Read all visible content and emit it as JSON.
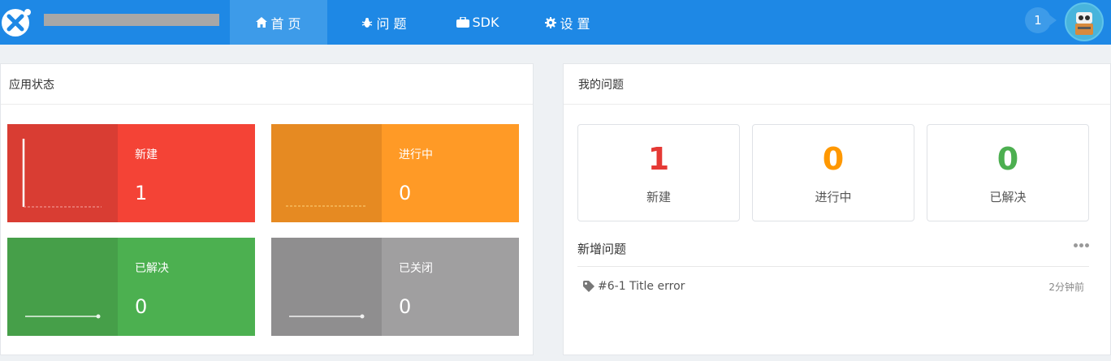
{
  "nav": {
    "home": "首 页",
    "issues": "问 题",
    "sdk": "SDK",
    "settings": "设 置"
  },
  "notifications": {
    "count": "1"
  },
  "app_status": {
    "title": "应用状态",
    "tiles": [
      {
        "label": "新建",
        "value": "1",
        "spark_color": "#ffffff"
      },
      {
        "label": "进行中",
        "value": "0"
      },
      {
        "label": "已解决",
        "value": "0"
      },
      {
        "label": "已关闭",
        "value": "0"
      }
    ]
  },
  "my_issues": {
    "title": "我的问题",
    "stats": [
      {
        "value": "1",
        "label": "新建",
        "color": "#e53935"
      },
      {
        "value": "0",
        "label": "进行中",
        "color": "#ff9800"
      },
      {
        "value": "0",
        "label": "已解决",
        "color": "#4caf50"
      }
    ],
    "new_issues": {
      "title": "新增问题",
      "items": [
        {
          "title": "#6-1 Title error",
          "time": "2分钟前"
        }
      ]
    }
  },
  "colors": {
    "topbar": "#1e88e5",
    "new": "#f44336",
    "in_progress": "#ff9a26",
    "solved": "#4cb050",
    "closed": "#a09fa0"
  }
}
